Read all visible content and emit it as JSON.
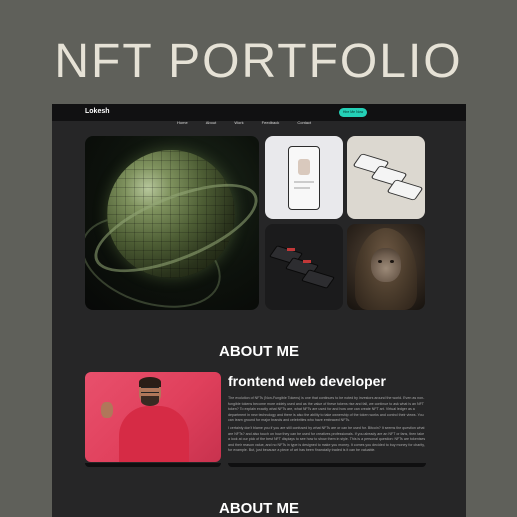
{
  "promo": {
    "title": "NFT PORTFOLIO"
  },
  "nav": {
    "logo": "Lokesh",
    "links": [
      "Home",
      "About",
      "Work",
      "Feedback",
      "Contact"
    ],
    "cta": "Hire Me Now"
  },
  "gallery": {
    "items": [
      "globe-art",
      "phone-mockup",
      "devices-mockup",
      "dark-phones",
      "hooded-ape"
    ]
  },
  "about": {
    "section_title": "ABOUT ME",
    "heading": "frontend web developer",
    "paragraph_1": "The evolution of NFTs (Non-Fungible Tokens) is one that continues to be noted by investors around the world. Even as non-fungible tokens become more widely used and as the value of these tokens rise and fall, we continue to ask what is an NFT token? To explain exactly what NFTs are, what NFTs are used for and how one can create NFT art. Virtual ledger as a department in new technology and there is also the ability to take ownership of the token works and control their views. You can learn ground for major brands and celebrities who have embraced NFTs.",
    "paragraph_2": "I certainly don't blame you if you are still confused by what NFTs are or can be used for. Bitcoin? It seems the question what are NFTs? and also touch on how they can be used for creatives professionals. If you already are an NFT or fans, then take a look at our pick of the best NFT displays to see how to show them in style. This is a personal question: NFTs are tokenises and their reason value, and no NFTs in type is designed to make you money. It comes you decided to buy money for charity, for example. But, just because a piece of art has been financially traded is it can be valuable."
  },
  "about_repeat": {
    "section_title": "ABOUT ME"
  }
}
